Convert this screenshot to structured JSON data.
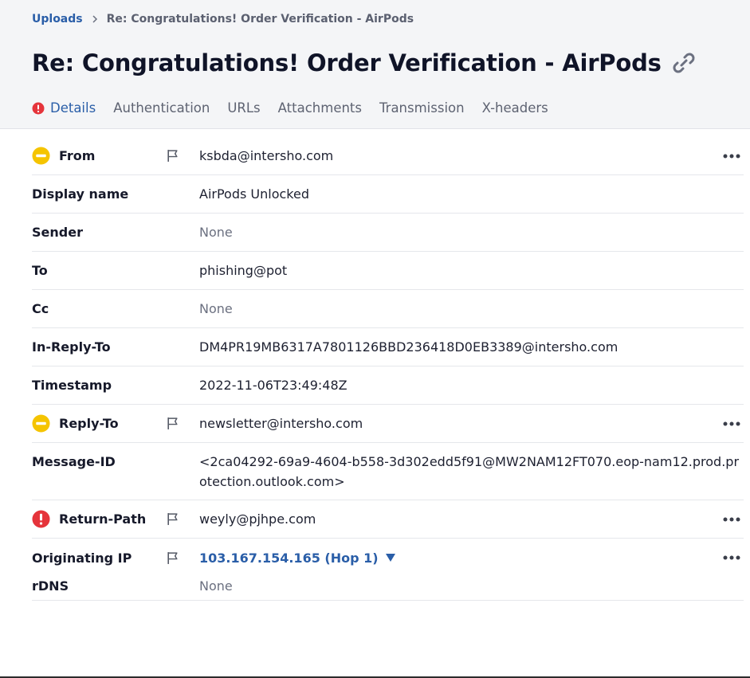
{
  "breadcrumb": {
    "root": "Uploads",
    "current": "Re: Congratulations! Order Verification - AirPods"
  },
  "title": "Re: Congratulations! Order Verification - AirPods",
  "tabs": [
    {
      "label": "Details",
      "active": true,
      "alert": true
    },
    {
      "label": "Authentication",
      "active": false
    },
    {
      "label": "URLs",
      "active": false
    },
    {
      "label": "Attachments",
      "active": false
    },
    {
      "label": "Transmission",
      "active": false
    },
    {
      "label": "X-headers",
      "active": false
    }
  ],
  "fields": {
    "from": {
      "label": "From",
      "value": "ksbda@intersho.com",
      "status": "warning",
      "icon": "minus-circle-icon"
    },
    "display_name": {
      "label": "Display name",
      "value": "AirPods Unlocked"
    },
    "sender": {
      "label": "Sender",
      "value": "None"
    },
    "to": {
      "label": "To",
      "value": "phishing@pot"
    },
    "cc": {
      "label": "Cc",
      "value": "None"
    },
    "in_reply_to": {
      "label": "In-Reply-To",
      "value": "DM4PR19MB6317A7801126BBD236418D0EB3389@intersho.com"
    },
    "timestamp": {
      "label": "Timestamp",
      "value": "2022-11-06T23:49:48Z"
    },
    "reply_to": {
      "label": "Reply-To",
      "value": "newsletter@intersho.com",
      "status": "warning",
      "icon": "minus-circle-icon"
    },
    "message_id": {
      "label": "Message-ID",
      "value": "<2ca04292-69a9-4604-b558-3d302edd5f91@MW2NAM12FT070.eop-nam12.prod.protection.outlook.com>"
    },
    "return_path": {
      "label": "Return-Path",
      "value": "weyly@pjhpe.com",
      "status": "danger",
      "icon": "exclamation-circle-icon"
    },
    "originating_ip": {
      "label": "Originating IP",
      "value": "103.167.154.165 (Hop 1)"
    },
    "rdns": {
      "label": "rDNS",
      "value": "None"
    }
  },
  "colors": {
    "accent": "#2a5ea8",
    "warning": "#f5c400",
    "danger": "#e5343b",
    "header_bg": "#f4f5f7"
  },
  "icons": {
    "flag": "flag-icon",
    "more": "more-dots-icon",
    "link": "link-icon",
    "breadcrumb_sep": "chevron-right-icon",
    "ip_caret": "caret-down-icon"
  }
}
